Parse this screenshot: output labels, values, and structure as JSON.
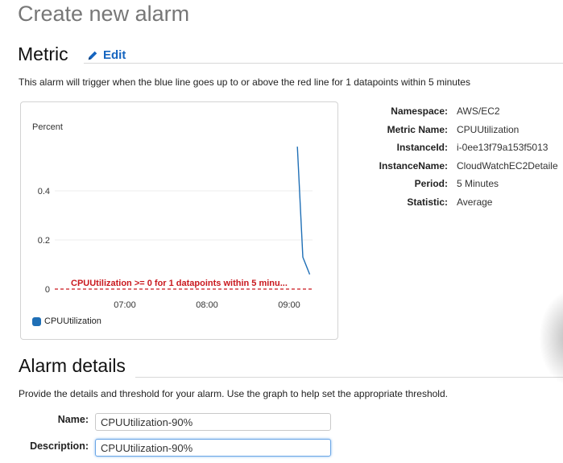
{
  "page": {
    "title": "Create new alarm"
  },
  "metric": {
    "heading": "Metric",
    "edit_label": "Edit",
    "description": "This alarm will trigger when the blue line goes up to or above the red line for 1 datapoints within 5 minutes"
  },
  "chart_data": {
    "type": "line",
    "ylabel": "Percent",
    "ylim": [
      0,
      0.6
    ],
    "y_ticks": [
      "0",
      "0.2",
      "0.4"
    ],
    "x_ticks": [
      "07:00",
      "08:00",
      "09:00"
    ],
    "series": [
      {
        "name": "CPUUtilization",
        "color": "#1f6fb6",
        "x": [
          "09:06",
          "09:10",
          "09:15"
        ],
        "values": [
          0.58,
          0.13,
          0.06
        ]
      }
    ],
    "threshold": {
      "value": 0,
      "color": "#c9181e",
      "label": "CPUUtilization >= 0 for 1 datapoints within 5 minu..."
    },
    "legend": {
      "position": "bottom-left",
      "label": "CPUUtilization"
    },
    "grid": true
  },
  "details": [
    {
      "key": "Namespace:",
      "value": "AWS/EC2"
    },
    {
      "key": "Metric Name:",
      "value": "CPUUtilization"
    },
    {
      "key": "InstanceId:",
      "value": "i-0ee13f79a153f5013"
    },
    {
      "key": "InstanceName:",
      "value": "CloudWatchEC2Detaile"
    },
    {
      "key": "Period:",
      "value": "5 Minutes"
    },
    {
      "key": "Statistic:",
      "value": "Average"
    }
  ],
  "alarm_details": {
    "heading": "Alarm details",
    "description": "Provide the details and threshold for your alarm. Use the graph to help set the appropriate threshold.",
    "name_label": "Name:",
    "name_value": "CPUUtilization-90%",
    "description_label": "Description:",
    "description_value": "CPUUtilization-90%"
  },
  "colors": {
    "link": "#1565c0",
    "series": "#1f6fb6",
    "threshold": "#c9181e"
  }
}
